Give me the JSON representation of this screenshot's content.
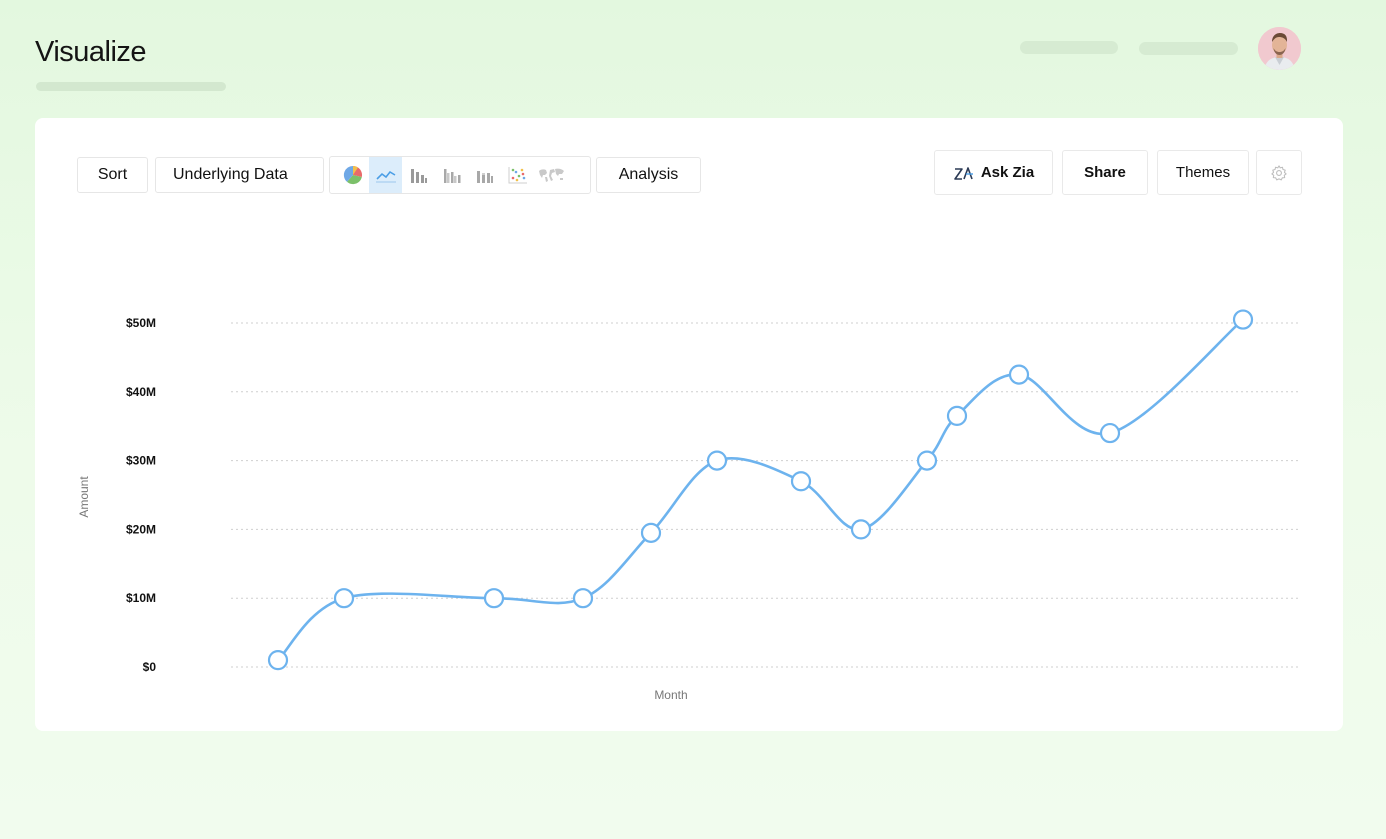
{
  "header": {
    "title": "Visualize"
  },
  "toolbar": {
    "sort_label": "Sort",
    "underlying_label": "Underlying Data",
    "analysis_label": "Analysis",
    "chart_types": [
      {
        "name": "pie-chart-icon",
        "active": false
      },
      {
        "name": "line-chart-icon",
        "active": true
      },
      {
        "name": "bar-chart-icon",
        "active": false
      },
      {
        "name": "grouped-bar-chart-icon",
        "active": false
      },
      {
        "name": "stacked-bar-chart-icon",
        "active": false
      },
      {
        "name": "scatter-chart-icon",
        "active": false
      },
      {
        "name": "map-chart-icon",
        "active": false
      }
    ],
    "ask_zia_label": "Ask Zia",
    "share_label": "Share",
    "themes_label": "Themes",
    "settings_icon": "gear-icon"
  },
  "colors": {
    "series": "#6db3ee",
    "active_chart_type": "#dcedfb",
    "background": "#e3f8df"
  },
  "chart_data": {
    "type": "line",
    "xlabel": "Month",
    "ylabel": "Amount",
    "y_ticks": [
      {
        "value": 0,
        "label": "$0"
      },
      {
        "value": 10,
        "label": "$10M"
      },
      {
        "value": 20,
        "label": "$20M"
      },
      {
        "value": 30,
        "label": "$30M"
      },
      {
        "value": 40,
        "label": "$40M"
      },
      {
        "value": 50,
        "label": "$50M"
      }
    ],
    "ylim": [
      0,
      50
    ],
    "grid": true,
    "smooth": true,
    "series": [
      {
        "values": [
          1,
          10,
          10,
          10,
          19.5,
          30,
          27,
          20,
          30,
          36.5,
          42.5,
          34,
          50.5
        ]
      }
    ]
  }
}
